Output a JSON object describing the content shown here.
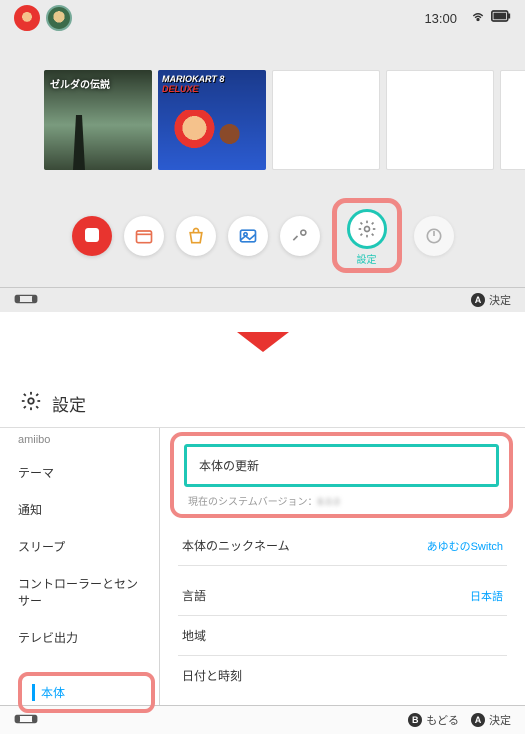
{
  "status": {
    "time": "13:00"
  },
  "tiles": {
    "zelda_title": "ゼルダの伝説",
    "mk_title_line1": "MARIOKART 8",
    "mk_title_line2": "DELUXE"
  },
  "dock": {
    "online_label": "",
    "settings_label": "設定"
  },
  "footer_top": {
    "confirm": "決定"
  },
  "settings_header": "設定",
  "left_menu": {
    "faded": "amiibo",
    "theme": "テーマ",
    "notify": "通知",
    "sleep": "スリープ",
    "controllers": "コントローラーとセンサー",
    "tv": "テレビ出力",
    "system": "本体"
  },
  "right": {
    "update": "本体の更新",
    "version_prefix": "現在のシステムバージョン：",
    "version_value": "8.0.0",
    "nickname_label": "本体のニックネーム",
    "nickname_value": "あゆむのSwitch",
    "lang_label": "言語",
    "lang_value": "日本語",
    "region_label": "地域",
    "datetime_label": "日付と時刻"
  },
  "footer_bottom": {
    "back": "もどる",
    "confirm": "決定"
  }
}
